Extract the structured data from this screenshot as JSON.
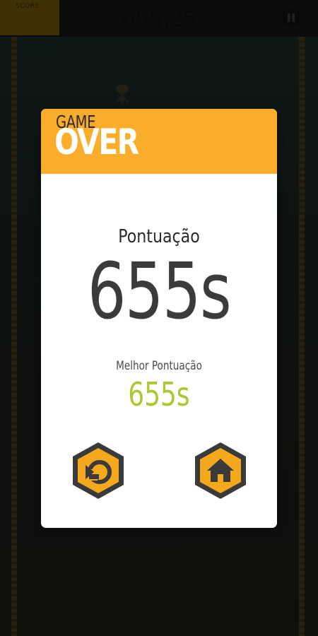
{
  "hud": {
    "score_chip_label": "SCORE",
    "timer": "655,25",
    "pause_icon": "pause-icon"
  },
  "modal": {
    "title_top": "GAME",
    "title_bottom": "OVER",
    "score_label": "Pontuação",
    "score_value": "655s",
    "best_label": "Melhor Pontuação",
    "best_value": "655s",
    "restart_icon": "restart-icon",
    "home_icon": "home-icon"
  },
  "colors": {
    "accent_orange": "#f9ad2a",
    "best_green": "#a9c932",
    "hex_dark": "#3a3a3a",
    "hex_fill": "#f4a81d"
  }
}
